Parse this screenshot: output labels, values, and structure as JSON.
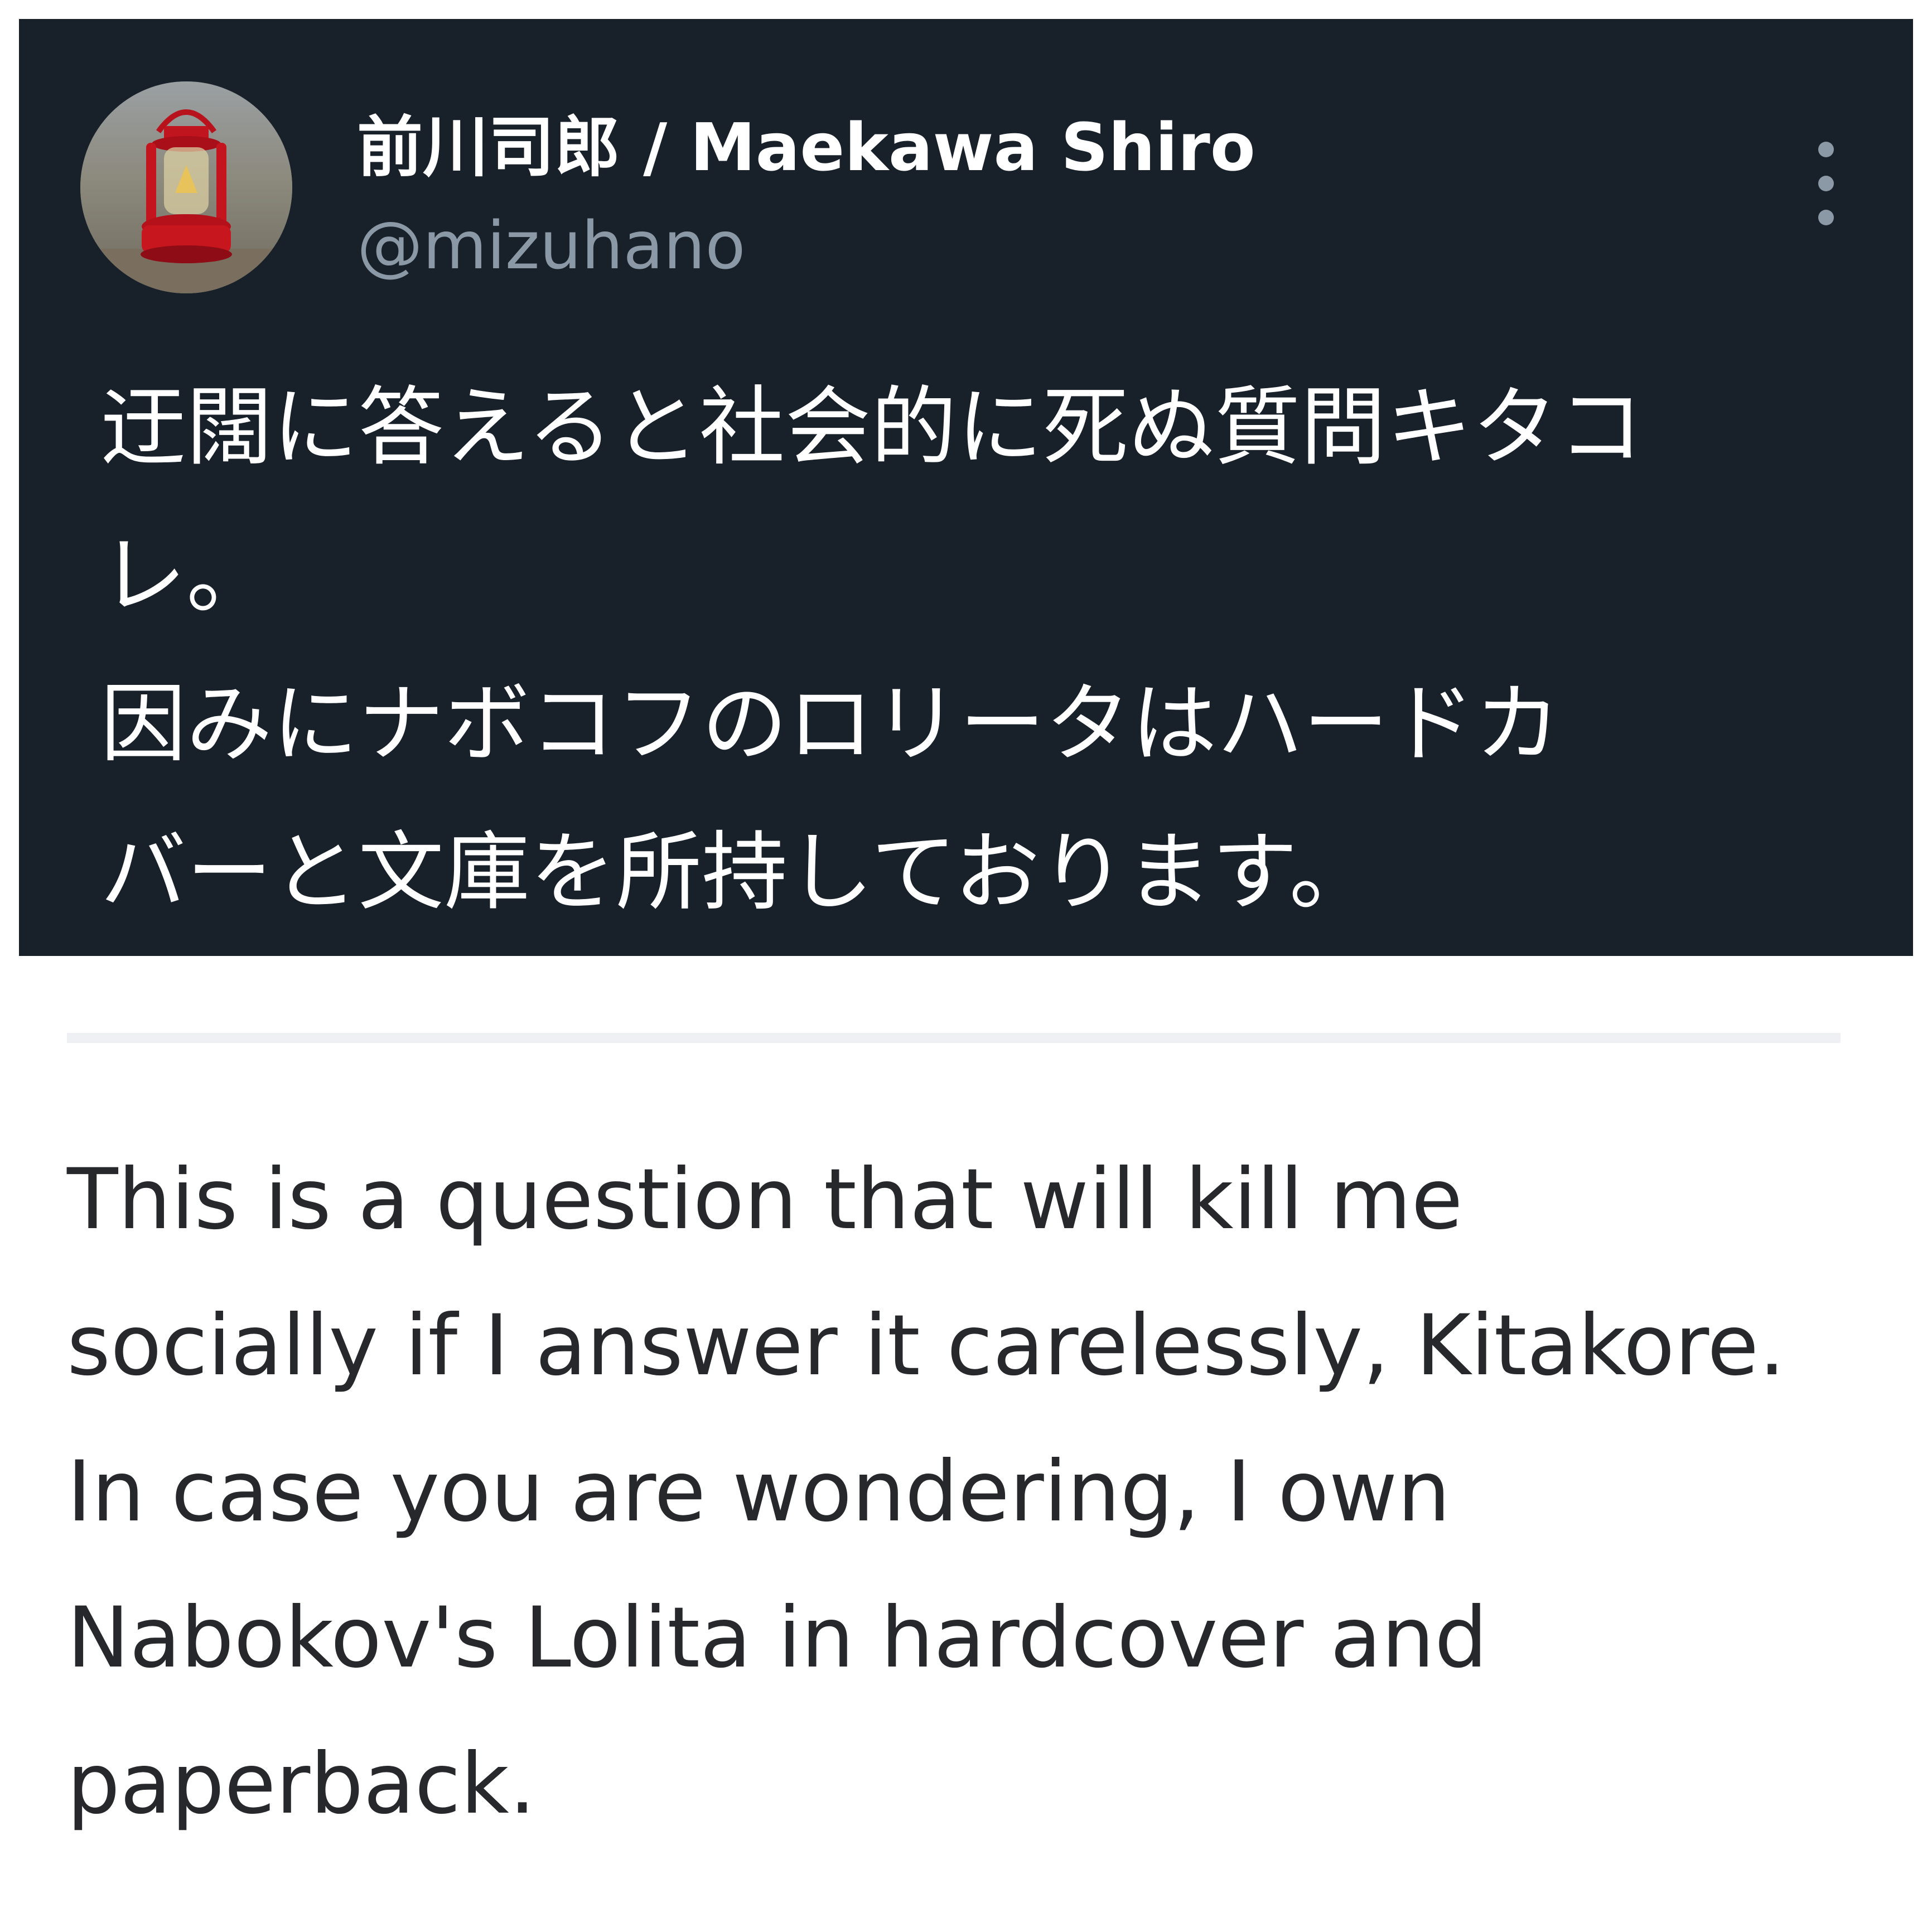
{
  "tweet": {
    "display_name": "前川司郎 / Maekawa Shiro",
    "handle": "@mizuhano",
    "more_icon": "more-vertical-icon",
    "avatar_icon": "red-lantern-avatar",
    "text_lines": [
      "迂闊に答えると社会的に死ぬ質問キタコ",
      "レ。",
      "因みにナボコフのロリータはハードカ",
      "バーと文庫を所持しております。"
    ],
    "colors": {
      "card_background": "#18202a",
      "name": "#ffffff",
      "handle": "#8b98a5"
    }
  },
  "translation": {
    "lines": [
      "This is a question that will kill me",
      "socially if I answer it carelessly, Kitakore.",
      "In case you are wondering, I own",
      "Nabokov's Lolita in hardcover and",
      "paperback."
    ],
    "text_color": "#26282c"
  }
}
